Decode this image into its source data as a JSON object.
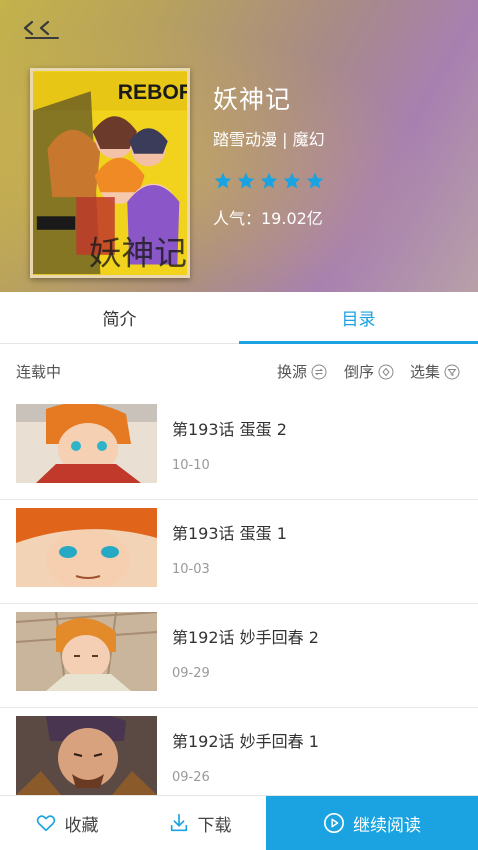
{
  "header": {
    "back_icon": "back-arrow-icon",
    "title": "妖神记",
    "meta": "踏雪动漫 | 魔幻",
    "rating": 5,
    "star_color": "#1aa3e0",
    "popularity": "人气：19.02亿",
    "cover_text": "REBORN"
  },
  "tabs": [
    {
      "label": "简介",
      "active": false
    },
    {
      "label": "目录",
      "active": true
    }
  ],
  "toolbar": {
    "status": "连载中",
    "source_label": "换源",
    "order_label": "倒序",
    "select_label": "选集"
  },
  "chapters": [
    {
      "title": "第193话 蛋蛋 2",
      "date": "10-10"
    },
    {
      "title": "第193话 蛋蛋 1",
      "date": "10-03"
    },
    {
      "title": "第192话 妙手回春 2",
      "date": "09-29"
    },
    {
      "title": "第192话 妙手回春 1",
      "date": "09-26"
    }
  ],
  "bottom": {
    "favorite_label": "收藏",
    "download_label": "下载",
    "read_label": "继续阅读"
  },
  "colors": {
    "accent": "#1aa3e0"
  }
}
